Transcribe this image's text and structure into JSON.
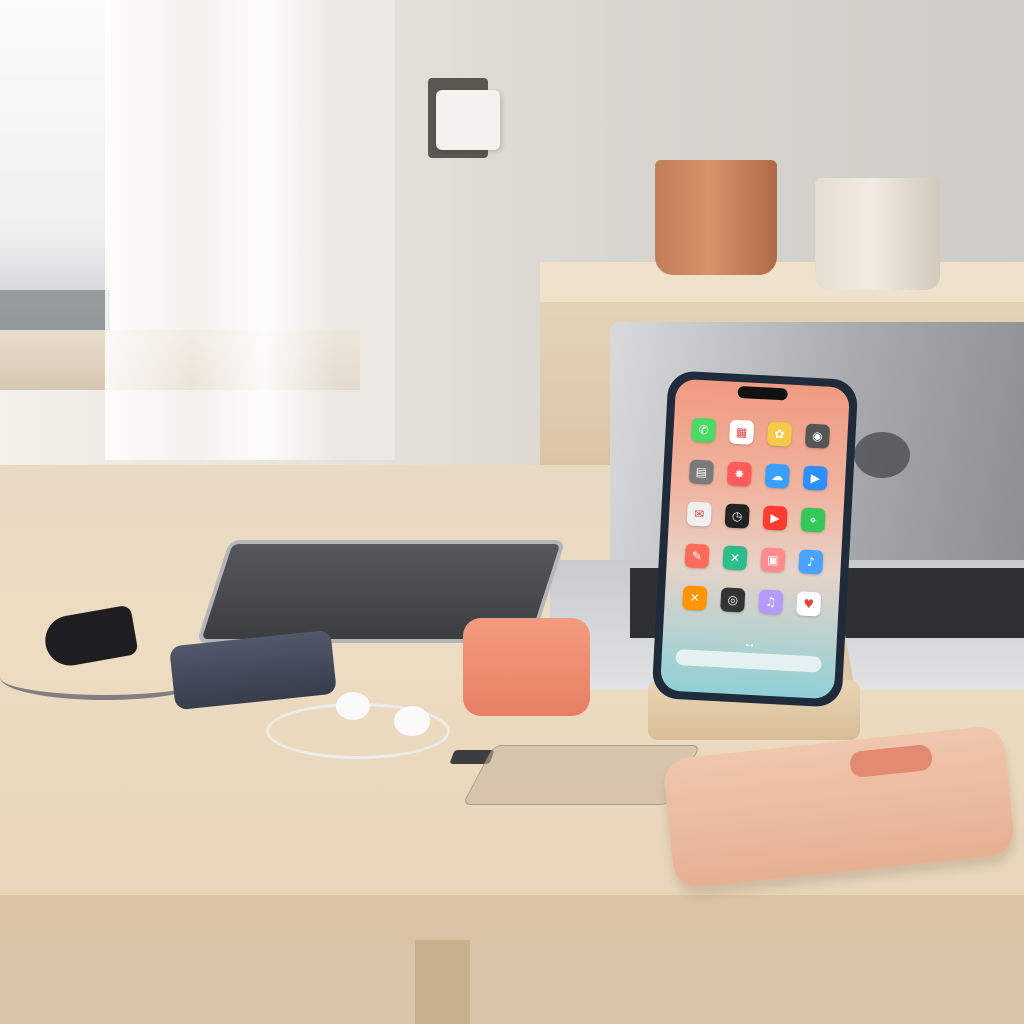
{
  "scene": {
    "type": "photograph",
    "description_items": [
      "wall-outlet-with-charger",
      "potted-plant-terracotta",
      "potted-plant-cream",
      "wooden-cabinet",
      "laptop",
      "tablet",
      "phone-on-stand",
      "car-charger",
      "power-bank",
      "earbuds-case",
      "wired-earbuds",
      "sd-card",
      "screen-protector",
      "phone-case"
    ]
  },
  "phone": {
    "apps": [
      {
        "icon": "phone-icon",
        "color": "#4cd964",
        "glyph": "✆"
      },
      {
        "icon": "calendar-icon",
        "color": "#ffffff",
        "glyph": "▦"
      },
      {
        "icon": "photos-icon",
        "color": "#f7c948",
        "glyph": "✿"
      },
      {
        "icon": "camera-icon",
        "color": "#555555",
        "glyph": "◉"
      },
      {
        "icon": "news-icon",
        "color": "#7a7a7a",
        "glyph": "▤"
      },
      {
        "icon": "safari-icon",
        "color": "#ff5b5b",
        "glyph": "✸"
      },
      {
        "icon": "weather-icon",
        "color": "#3aa0ff",
        "glyph": "☁"
      },
      {
        "icon": "video-icon",
        "color": "#2e8fff",
        "glyph": "▶"
      },
      {
        "icon": "mail-icon",
        "color": "#f0f0f0",
        "glyph": "✉"
      },
      {
        "icon": "clock-icon",
        "color": "#222222",
        "glyph": "◷"
      },
      {
        "icon": "youtube-icon",
        "color": "#ff3b30",
        "glyph": "▶"
      },
      {
        "icon": "maps-icon",
        "color": "#34c759",
        "glyph": "⌖"
      },
      {
        "icon": "tools-icon",
        "color": "#ff6b5b",
        "glyph": "✎"
      },
      {
        "icon": "xcross-icon",
        "color": "#2dbd8a",
        "glyph": "✕"
      },
      {
        "icon": "tv-icon",
        "color": "#ff8c8c",
        "glyph": "▣"
      },
      {
        "icon": "bird-icon",
        "color": "#4aa3ff",
        "glyph": "♪"
      },
      {
        "icon": "x-icon",
        "color": "#ff9500",
        "glyph": "✕"
      },
      {
        "icon": "circle-icon",
        "color": "#333333",
        "glyph": "◎"
      },
      {
        "icon": "music-icon",
        "color": "#b59bff",
        "glyph": "♫"
      },
      {
        "icon": "heart-icon",
        "color": "#ffffff",
        "glyph": "♥"
      }
    ],
    "page_dots": "• •"
  }
}
